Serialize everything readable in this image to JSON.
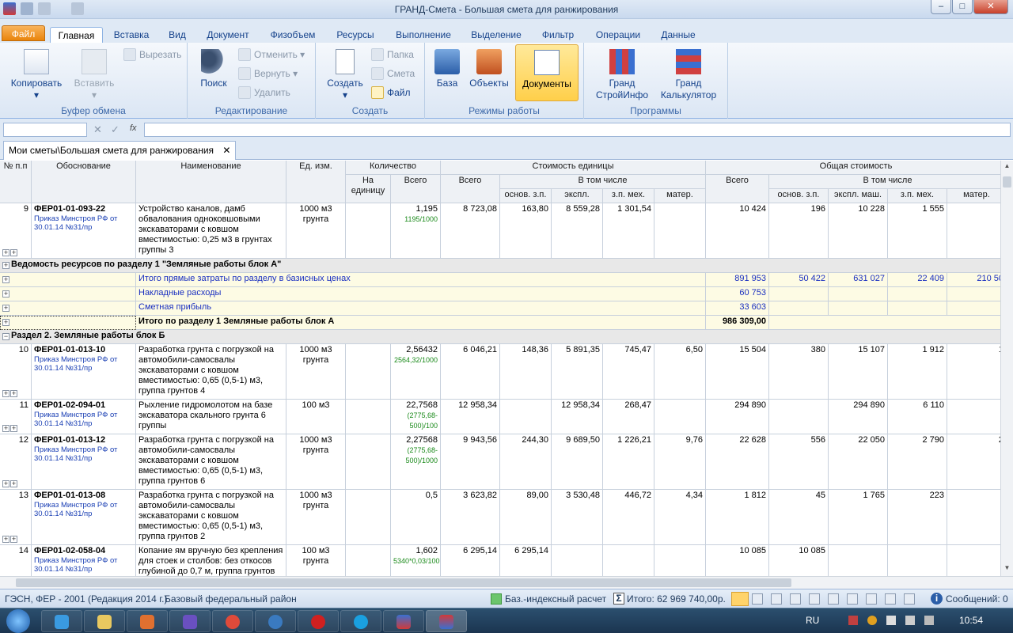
{
  "window": {
    "title": "ГРАНД-Смета - Большая смета для ранжирования",
    "min": "–",
    "max": "□",
    "close": "✕"
  },
  "tabs": [
    "Файл",
    "Главная",
    "Вставка",
    "Вид",
    "Документ",
    "Физобъем",
    "Ресурсы",
    "Выполнение",
    "Выделение",
    "Фильтр",
    "Операции",
    "Данные"
  ],
  "ribbon": {
    "clipboard": {
      "name": "Буфер обмена",
      "copy": "Копировать",
      "paste": "Вставить",
      "cut": "Вырезать"
    },
    "editing": {
      "name": "Редактирование",
      "search": "Поиск",
      "undo": "Отменить",
      "redo": "Вернуть",
      "delete": "Удалить"
    },
    "create": {
      "name": "Создать",
      "create": "Создать",
      "folder": "Папка",
      "estimate": "Смета",
      "file": "Файл"
    },
    "modes": {
      "name": "Режимы работы",
      "base": "База",
      "objects": "Объекты",
      "documents": "Документы"
    },
    "programs": {
      "name": "Программы",
      "grand_info": "Гранд СтройИнфо",
      "grand_calc": "Гранд Калькулятор"
    }
  },
  "formula": {
    "fx": "fx"
  },
  "doc_tab": {
    "label": "Мои сметы\\Большая смета для ранжирования",
    "close": "✕"
  },
  "headers": {
    "num": "№ п.п",
    "basis": "Обоснование",
    "name": "Наименование",
    "unit": "Ед. изм.",
    "qty": "Количество",
    "qty_per": "На единицу",
    "qty_total": "Всего",
    "unit_cost": "Стоимость единицы",
    "uc_total": "Всего",
    "incl": "В том числе",
    "zp": "основ. з.п.",
    "em": "экспл. маш.",
    "zpm": "з.п. мех.",
    "mat": "матер.",
    "total_cost": "Общая стоимость",
    "tc_total": "Всего"
  },
  "rows": [
    {
      "n": "9",
      "code": "ФЕР01-01-093-22",
      "src": "Приказ Минстроя РФ от 30.01.14 №31/пр",
      "name": "Устройство каналов, дамб обвалования одноковшовыми экскаваторами с ковшом вместимостью: 0,25 м3 в грунтах группы 3",
      "unit": "1000 м3 грунта",
      "qty": "1,195",
      "qf": "1195/1000",
      "uc": "8 723,08",
      "zp": "163,80",
      "em": "8 559,28",
      "zpm": "1 301,54",
      "mat": "",
      "tc": "10 424",
      "tzp": "196",
      "tem": "10 228",
      "tzpm": "1 555",
      "tmat": ""
    },
    {
      "n": "10",
      "code": "ФЕР01-01-013-10",
      "src": "Приказ Минстроя РФ от 30.01.14 №31/пр",
      "name": "Разработка грунта с погрузкой на автомобили-самосвалы экскаваторами с ковшом вместимостью: 0,65 (0,5-1) м3, группа грунтов 4",
      "unit": "1000 м3 грунта",
      "qty": "2,56432",
      "qf": "2564,32/1000",
      "uc": "6 046,21",
      "zp": "148,36",
      "em": "5 891,35",
      "zpm": "745,47",
      "mat": "6,50",
      "tc": "15 504",
      "tzp": "380",
      "tem": "15 107",
      "tzpm": "1 912",
      "tmat": "1"
    },
    {
      "n": "11",
      "code": "ФЕР01-02-094-01",
      "src": "Приказ Минстроя РФ от 30.01.14 №31/пр",
      "name": "Рыхление гидромолотом на базе экскаватора скального грунта 6 группы",
      "unit": "100 м3",
      "qty": "22,7568",
      "qf": "(2775,68-500)/100",
      "uc": "12 958,34",
      "zp": "",
      "em": "12 958,34",
      "zpm": "268,47",
      "mat": "",
      "tc": "294 890",
      "tzp": "",
      "tem": "294 890",
      "tzpm": "6 110",
      "tmat": ""
    },
    {
      "n": "12",
      "code": "ФЕР01-01-013-12",
      "src": "Приказ Минстроя РФ от 30.01.14 №31/пр",
      "name": "Разработка грунта с погрузкой на автомобили-самосвалы экскаваторами с ковшом вместимостью: 0,65 (0,5-1) м3, группа грунтов 6",
      "unit": "1000 м3 грунта",
      "qty": "2,27568",
      "qf": "(2775,68-500)/1000",
      "uc": "9 943,56",
      "zp": "244,30",
      "em": "9 689,50",
      "zpm": "1 226,21",
      "mat": "9,76",
      "tc": "22 628",
      "tzp": "556",
      "tem": "22 050",
      "tzpm": "2 790",
      "tmat": "2"
    },
    {
      "n": "13",
      "code": "ФЕР01-01-013-08",
      "src": "Приказ Минстроя РФ от 30.01.14 №31/пр",
      "name": "Разработка грунта с погрузкой на автомобили-самосвалы экскаваторами с ковшом вместимостью: 0,65 (0,5-1) м3, группа грунтов 2",
      "unit": "1000 м3 грунта",
      "qty": "0,5",
      "qf": "",
      "uc": "3 623,82",
      "zp": "89,00",
      "em": "3 530,48",
      "zpm": "446,72",
      "mat": "4,34",
      "tc": "1 812",
      "tzp": "45",
      "tem": "1 765",
      "tzpm": "223",
      "tmat": ""
    },
    {
      "n": "14",
      "code": "ФЕР01-02-058-04",
      "src": "Приказ Минстроя РФ от 30.01.14 №31/пр",
      "name": "Копание ям вручную без крепления для стоек и столбов: без откосов глубиной до 0,7 м, группа грунтов",
      "unit": "100 м3 грунта",
      "qty": "1,602",
      "qf": "5340*0,03/100",
      "uc": "6 295,14",
      "zp": "6 295,14",
      "em": "",
      "zpm": "",
      "mat": "",
      "tc": "10 085",
      "tzp": "10 085",
      "tem": "",
      "tzpm": "",
      "tmat": ""
    }
  ],
  "sections": {
    "resources": "Ведомость ресурсов по разделу 1 \"Земляные работы блок А\"",
    "direct": {
      "label": "Итого прямые затраты по разделу в базисных ценах",
      "tc": "891 953",
      "tzp": "50 422",
      "tem": "631 027",
      "tzpm": "22 409",
      "tmat": "210 50"
    },
    "overhead": {
      "label": "Накладные расходы",
      "tc": "60 753"
    },
    "profit": {
      "label": "Сметная прибыль",
      "tc": "33 603"
    },
    "total": {
      "label": "Итого по разделу 1 Земляные работы блок А",
      "tc": "986 309,00"
    },
    "section2": "Раздел 2. Земляные работы блок Б"
  },
  "status": {
    "norm": "ГЭСН, ФЕР - 2001 (Редакция 2014 г.)",
    "region": "Базовый федеральный район",
    "calc": "Баз.-индексный расчет",
    "sigma": "Σ",
    "total": "Итого: 62 969 740,00р.",
    "info": "i",
    "messages": "Сообщений: 0"
  },
  "taskbar": {
    "lang": "RU",
    "time": "10:54"
  }
}
